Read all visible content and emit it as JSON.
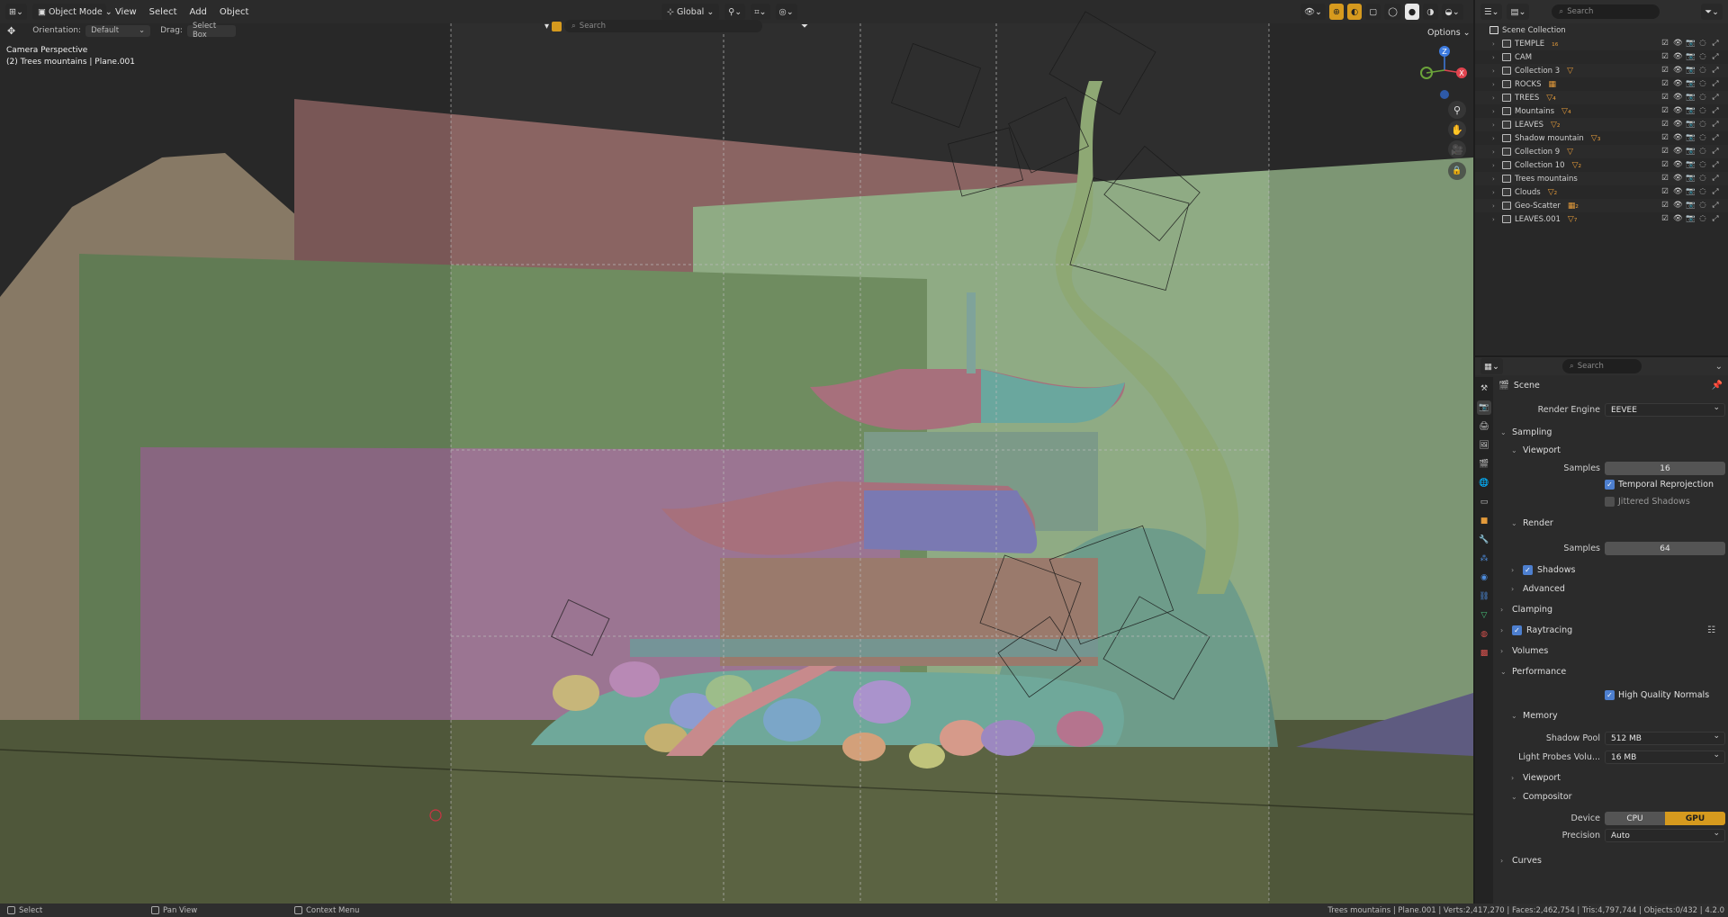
{
  "header": {
    "mode_label": "Object Mode",
    "menus": [
      "View",
      "Select",
      "Add",
      "Object"
    ],
    "transform_orientation": "Global",
    "search_placeholder": "Search",
    "options_label": "Options"
  },
  "tool_header": {
    "orientation_label": "Orientation:",
    "orientation_value": "Default",
    "drag_label": "Drag:",
    "drag_value": "Select Box"
  },
  "viewport": {
    "view_name": "Camera Perspective",
    "active_info": "(2) Trees mountains | Plane.001",
    "gizmo": {
      "z": "Z",
      "x": "X"
    }
  },
  "outliner": {
    "search_placeholder": "Search",
    "root": "Scene Collection",
    "items": [
      {
        "name": "TEMPLE",
        "badge": "₁₆"
      },
      {
        "name": "CAM",
        "badge": ""
      },
      {
        "name": "Collection 3",
        "badge": "▽"
      },
      {
        "name": "ROCKS",
        "badge": "▦"
      },
      {
        "name": "TREES",
        "badge": "▽₄"
      },
      {
        "name": "Mountains",
        "badge": "▽₄"
      },
      {
        "name": "LEAVES",
        "badge": "▽₂"
      },
      {
        "name": "Shadow mountain",
        "badge": "▽₃"
      },
      {
        "name": "Collection 9",
        "badge": "▽"
      },
      {
        "name": "Collection 10",
        "badge": "▽₂"
      },
      {
        "name": "Trees mountains",
        "badge": ""
      },
      {
        "name": "Clouds",
        "badge": "▽₂"
      },
      {
        "name": "Geo-Scatter",
        "badge": "▦₂"
      },
      {
        "name": "LEAVES.001",
        "badge": "▽₇"
      }
    ]
  },
  "properties": {
    "search_placeholder": "Search",
    "context": "Scene",
    "render_engine_label": "Render Engine",
    "render_engine": "EEVEE",
    "sampling": "Sampling",
    "viewport_sub": "Viewport",
    "samples_label": "Samples",
    "viewport_samples": "16",
    "temporal_reprojection": "Temporal Reprojection",
    "jittered_shadows": "Jittered Shadows",
    "render_sub": "Render",
    "render_samples": "64",
    "shadows": "Shadows",
    "advanced": "Advanced",
    "clamping": "Clamping",
    "raytracing": "Raytracing",
    "volumes": "Volumes",
    "performance": "Performance",
    "high_quality_normals": "High Quality Normals",
    "memory": "Memory",
    "shadow_pool_label": "Shadow Pool",
    "shadow_pool": "512 MB",
    "light_probes_label": "Light Probes Volu...",
    "light_probes": "16 MB",
    "viewport_perf": "Viewport",
    "compositor": "Compositor",
    "device_label": "Device",
    "device_cpu": "CPU",
    "device_gpu": "GPU",
    "precision_label": "Precision",
    "precision": "Auto",
    "curves": "Curves"
  },
  "statusbar": {
    "select": "Select",
    "pan_view": "Pan View",
    "context_menu": "Context Menu",
    "stats": "Trees mountains | Plane.001 | Verts:2,417,270 | Faces:2,462,754 | Tris:4,797,744 | Objects:0/432 | 4.2.0"
  },
  "colors": {
    "accent": "#d69a1e",
    "checkbox": "#4d7fcf",
    "axis_x": "#e0444f",
    "axis_y": "#6ba33a",
    "axis_z": "#3d7be0"
  }
}
